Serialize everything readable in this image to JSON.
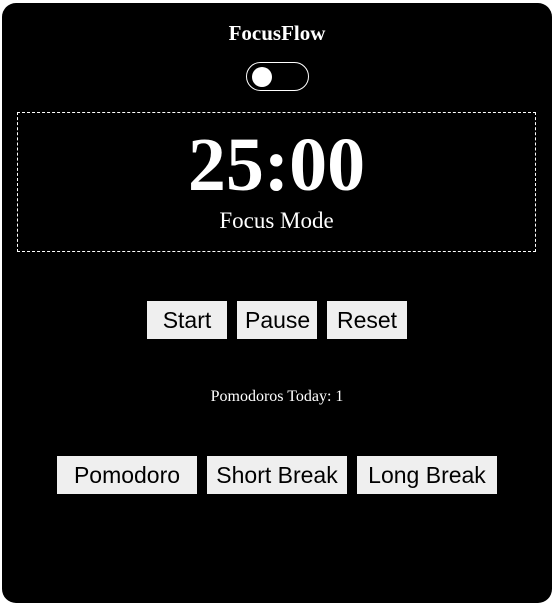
{
  "app": {
    "title": "FocusFlow"
  },
  "theme_toggle": {
    "state": "off",
    "icon": "toggle-switch-icon"
  },
  "timer": {
    "display": "25:00",
    "mode_label": "Focus Mode"
  },
  "controls": {
    "start_label": "Start",
    "pause_label": "Pause",
    "reset_label": "Reset"
  },
  "stats": {
    "pomodoros_text": "Pomodoros Today: 1"
  },
  "modes": {
    "pomodoro_label": "Pomodoro",
    "short_break_label": "Short Break",
    "long_break_label": "Long Break"
  },
  "colors": {
    "background": "#000000",
    "text": "#ffffff",
    "button_background": "#efefef",
    "button_text": "#000000"
  }
}
